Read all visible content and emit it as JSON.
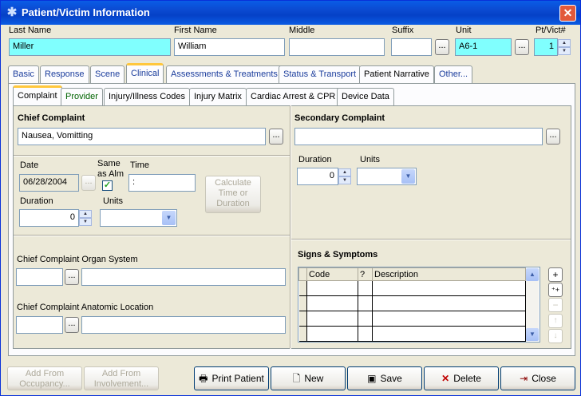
{
  "window": {
    "title": "Patient/Victim Information",
    "close": "✕"
  },
  "header": {
    "last_name_label": "Last Name",
    "last_name": "Miller",
    "first_name_label": "First Name",
    "first_name": "William",
    "middle_label": "Middle",
    "middle": "",
    "suffix_label": "Suffix",
    "suffix": "",
    "unit_label": "Unit",
    "unit": "A6-1",
    "ptvict_label": "Pt/Vict#",
    "ptvict": "1"
  },
  "main_tabs": [
    "Basic",
    "Response",
    "Scene",
    "Clinical",
    "Assessments & Treatments",
    "Status & Transport",
    "Patient Narrative",
    "Other..."
  ],
  "sub_tabs": [
    "Complaint",
    "Provider",
    "Injury/Illness Codes",
    "Injury Matrix",
    "Cardiac Arrest & CPR",
    "Device Data"
  ],
  "chief": {
    "title": "Chief Complaint",
    "value": "Nausea, Vomitting",
    "date_label": "Date",
    "date": "06/28/2004",
    "same_label_1": "Same",
    "same_label_2": "as Alm",
    "time_label": "Time",
    "time": ":",
    "calc_btn_1": "Calculate",
    "calc_btn_2": "Time or",
    "calc_btn_3": "Duration",
    "duration_label": "Duration",
    "duration": "0",
    "units_label": "Units",
    "organ_label": "Chief Complaint Organ System",
    "anatomic_label": "Chief Complaint Anatomic Location"
  },
  "secondary": {
    "title": "Secondary Complaint",
    "value": "",
    "duration_label": "Duration",
    "duration": "0",
    "units_label": "Units"
  },
  "signs": {
    "title": "Signs & Symptoms",
    "columns": [
      "Code",
      "?",
      "Description"
    ]
  },
  "footer": {
    "add_occupancy_1": "Add From",
    "add_occupancy_2": "Occupancy...",
    "add_involvement_1": "Add From",
    "add_involvement_2": "Involvement...",
    "print": "Print Patient",
    "new": "New",
    "save": "Save",
    "delete": "Delete",
    "close": "Close"
  },
  "colors": {
    "titlebar": "#0a5ce6",
    "highlight_field": "#80fffe",
    "active_tab_accent": "#ffc73c"
  }
}
